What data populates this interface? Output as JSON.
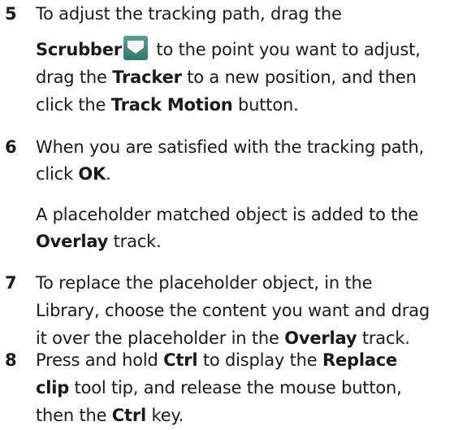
{
  "step5": {
    "number": "5",
    "l1": "To adjust the tracking path, drag the",
    "l2_b1": "Scrubber",
    "l2_t1": " to the point you want to adjust,",
    "l3_t1": "drag the ",
    "l3_b1": "Tracker",
    "l3_t2": " to a new position, and then",
    "l4_t1": "click the ",
    "l4_b1": "Track Motion",
    "l4_t2": " button.",
    "icon": "scrubber-icon"
  },
  "step6": {
    "number": "6",
    "l1": "When you are satisfied with the tracking path,",
    "l2_t1": "click ",
    "l2_b1": "OK",
    "l2_t2": ".",
    "note_l1": "A placeholder matched object is added to the",
    "note_b1": "Overlay",
    "note_t1": " track."
  },
  "step7": {
    "number": "7",
    "l1": "To replace the placeholder object, in the",
    "l2": "Library, choose the content you want and drag",
    "l3_t1": "it over the placeholder in the ",
    "l3_b1": "Overlay",
    "l3_t2": " track."
  },
  "step8": {
    "number": "8",
    "l1_t1": "Press and hold ",
    "l1_b1": "Ctrl",
    "l1_t2": " to display the ",
    "l1_b2": "Replace",
    "l2_b1": "clip",
    "l2_t1": " tool tip, and release the mouse button,",
    "l3_t1": "then the ",
    "l3_b1": "Ctrl",
    "l3_t2": " key."
  }
}
